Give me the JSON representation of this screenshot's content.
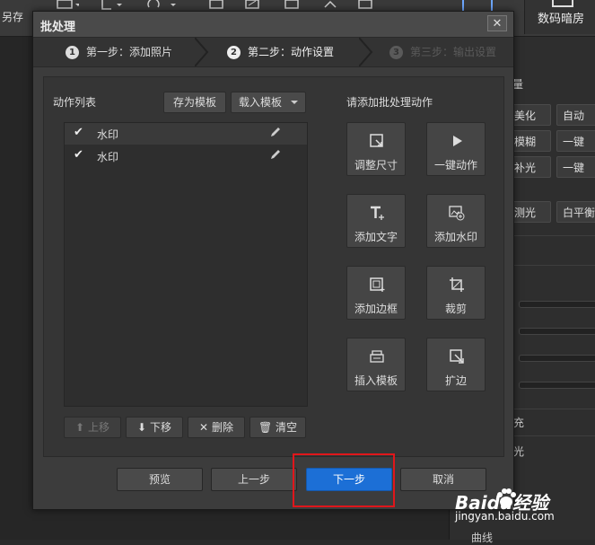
{
  "background": {
    "save_label": "另存",
    "tab_label": "数码暗房",
    "panel_buttons": [
      "美化",
      "自动",
      "模糊",
      "一键",
      "补光",
      "一键",
      "测光",
      "白平衡"
    ],
    "panel_partial_text": [
      "量",
      "充",
      "光",
      "曲线"
    ]
  },
  "dialog": {
    "title": "批处理",
    "close_symbol": "✕",
    "steps": [
      {
        "num": "1",
        "label": "第一步：添加照片"
      },
      {
        "num": "2",
        "label": "第二步：动作设置"
      },
      {
        "num": "3",
        "label": "第三步：输出设置"
      }
    ],
    "action_list": {
      "title": "动作列表",
      "save_template": "存为模板",
      "load_template": "载入模板",
      "items": [
        {
          "label": "水印",
          "checked": true
        },
        {
          "label": "水印",
          "checked": true
        }
      ],
      "move_up": "上移",
      "move_down": "下移",
      "delete": "删除",
      "clear": "清空"
    },
    "add_actions": {
      "title": "请添加批处理动作",
      "buttons": [
        {
          "label": "调整尺寸",
          "icon": "resize-icon"
        },
        {
          "label": "一键动作",
          "icon": "play-icon"
        },
        {
          "label": "添加文字",
          "icon": "text-icon"
        },
        {
          "label": "添加水印",
          "icon": "watermark-icon"
        },
        {
          "label": "添加边框",
          "icon": "border-icon"
        },
        {
          "label": "裁剪",
          "icon": "crop-icon"
        },
        {
          "label": "插入模板",
          "icon": "template-icon"
        },
        {
          "label": "扩边",
          "icon": "expand-icon"
        }
      ]
    },
    "footer": {
      "preview": "预览",
      "prev": "上一步",
      "next": "下一步",
      "cancel": "取消"
    }
  },
  "watermark": {
    "brand": "Baidu经验",
    "url": "jingyan.baidu.com"
  },
  "colors": {
    "primary": "#1c6fd6",
    "highlight": "#e0161b"
  }
}
